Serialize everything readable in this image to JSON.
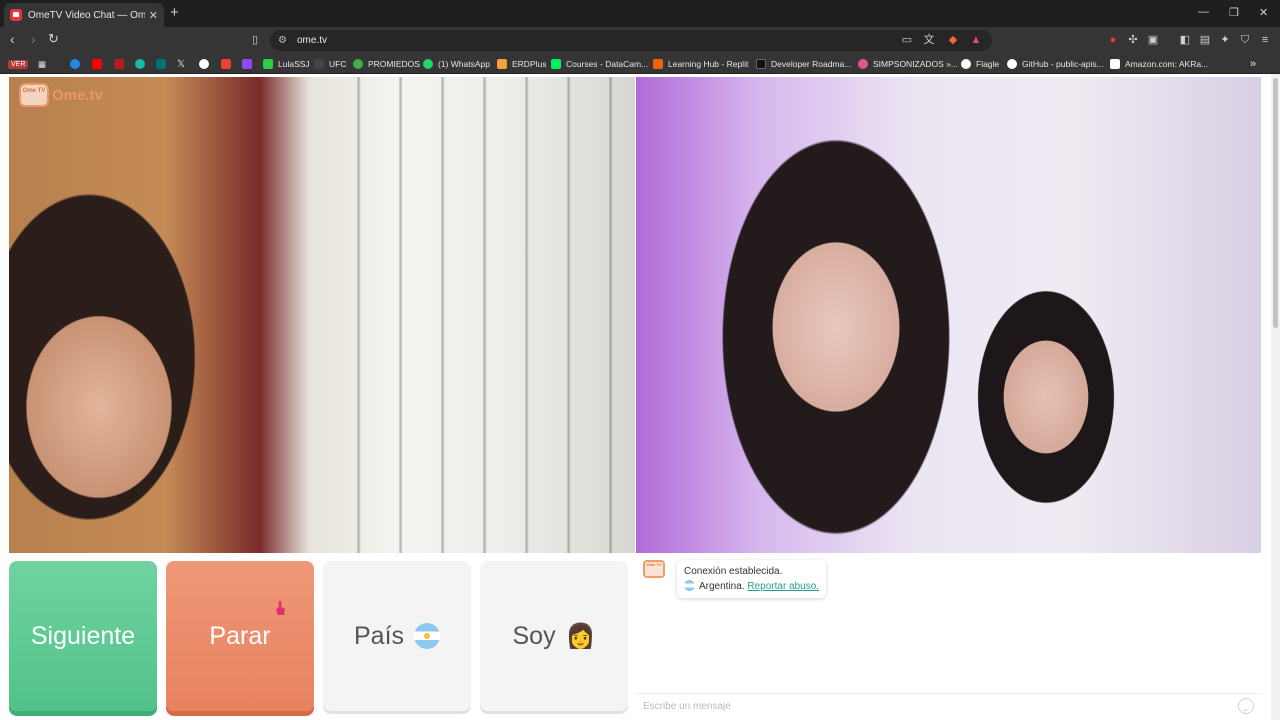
{
  "browser": {
    "tab": {
      "title": "OmeTV Video Chat — Omeg",
      "close": "✕"
    },
    "new_tab": "+",
    "window_controls": {
      "minimize": "—",
      "restore": "❐",
      "close": "✕"
    },
    "url": "ome.tv",
    "bookmarks": [
      {
        "label": "LulaSSJ",
        "color": "#2ecc40"
      },
      {
        "label": "UFC",
        "color": "#222222"
      },
      {
        "label": "PROMIEDOS",
        "color": "#3cb043"
      },
      {
        "label": "(1) WhatsApp",
        "color": "#25d366"
      },
      {
        "label": "ERDPlus",
        "color": "#f2a33a"
      },
      {
        "label": "Courses - DataCam...",
        "color": "#03ef62"
      },
      {
        "label": "Learning Hub - Replit",
        "color": "#f26207"
      },
      {
        "label": "Developer Roadma...",
        "color": "#111111"
      },
      {
        "label": "SIMPSONIZADOS »...",
        "color": "#e05595"
      },
      {
        "label": "Flagle",
        "color": "#ffffff"
      },
      {
        "label": "GitHub - public-apis...",
        "color": "#ffffff"
      },
      {
        "label": "Amazon.com: AKRa...",
        "color": "#ffffff"
      }
    ],
    "ver_badge": "VER"
  },
  "page": {
    "logo": {
      "badge": "Ome TV",
      "text": "Ome.tv"
    },
    "buttons": {
      "next": "Siguiente",
      "stop": "Parar",
      "country": "País",
      "gender": "Soy"
    },
    "gender_icon": "👩",
    "chat": {
      "status": "Conexión establecida.",
      "country": "Argentina.",
      "report": "Reportar abuso.",
      "input_placeholder": "Escribe un mensaje"
    }
  },
  "colors": {
    "next_button": "#5fcb95",
    "stop_button": "#eb8d6b",
    "link": "#2a9d8f"
  }
}
